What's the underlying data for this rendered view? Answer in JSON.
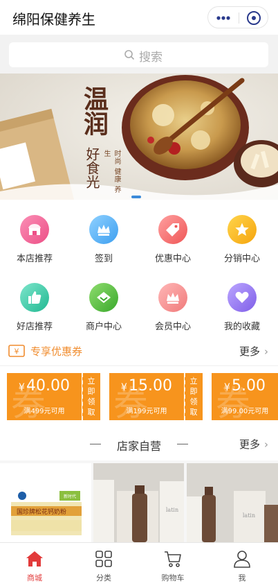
{
  "header": {
    "title": "绵阳保健养生"
  },
  "search": {
    "placeholder": "搜索"
  },
  "banner": {
    "title": "温润",
    "subtitle": "好食光",
    "tagline": "时尚 健康 养生"
  },
  "menu": [
    {
      "label": "本店推荐",
      "icon": "shop-icon",
      "color": "#f2669a"
    },
    {
      "label": "签到",
      "icon": "crown-icon",
      "color": "#58b4f0"
    },
    {
      "label": "优惠中心",
      "icon": "tag-icon",
      "color": "#f36d6d"
    },
    {
      "label": "分销中心",
      "icon": "star-icon",
      "color": "#f6b71d"
    },
    {
      "label": "好店推荐",
      "icon": "thumbs-up-icon",
      "color": "#44cfb0"
    },
    {
      "label": "商户中心",
      "icon": "diamond-icon",
      "color": "#5cc345"
    },
    {
      "label": "会员中心",
      "icon": "crown-icon",
      "color": "#f68a8a"
    },
    {
      "label": "我的收藏",
      "icon": "heart-icon",
      "color": "#9b7df0"
    }
  ],
  "coupon_section": {
    "title": "专享优惠券",
    "more": "更多"
  },
  "coupons": [
    {
      "amount": "40.00",
      "currency": "¥",
      "condition": "满499元可用",
      "claim": "立即领取",
      "watermark": "券"
    },
    {
      "amount": "15.00",
      "currency": "¥",
      "condition": "满199元可用",
      "claim": "立即领取",
      "watermark": "券"
    },
    {
      "amount": "5.00",
      "currency": "¥",
      "condition": "满99.00元可用",
      "claim": "",
      "watermark": "券"
    }
  ],
  "store_section": {
    "title": "店家自营",
    "more": "更多"
  },
  "products": [
    {
      "box_text": "国珍牌松花钙奶粉",
      "brand": "新时代"
    },
    {
      "brand": "latin"
    },
    {
      "brand": "latin"
    }
  ],
  "tabbar": [
    {
      "label": "商城",
      "icon": "home-icon",
      "active": true
    },
    {
      "label": "分类",
      "icon": "category-icon",
      "active": false
    },
    {
      "label": "购物车",
      "icon": "cart-icon",
      "active": false
    },
    {
      "label": "我",
      "icon": "user-icon",
      "active": false
    }
  ],
  "colors": {
    "accent": "#f7941d",
    "active_tab": "#e23b3b",
    "coupon_title": "#f08c2e"
  }
}
